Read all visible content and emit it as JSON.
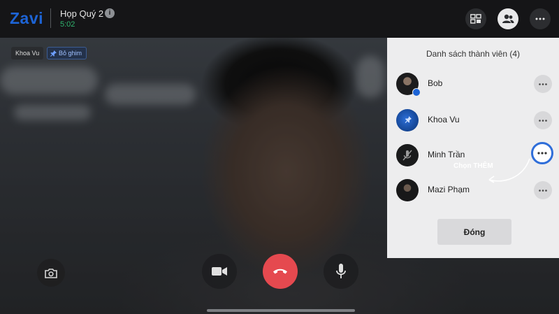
{
  "header": {
    "logo": "Zavi",
    "meeting_title": "Họp Quý 2",
    "info_glyph": "i",
    "timer": "5:02",
    "icons": [
      "layout-icon",
      "members-icon",
      "more-icon"
    ]
  },
  "video": {
    "name_tag": "Khoa Vu",
    "pin_tag": "Bỏ ghim"
  },
  "members_panel": {
    "title": "Danh sách thành viên (4)",
    "members": [
      {
        "name": "Bob"
      },
      {
        "name": "Khoa Vu"
      },
      {
        "name": "Minh Trần"
      },
      {
        "name": "Mazi Phạm"
      }
    ],
    "close_label": "Đóng"
  },
  "annotation": {
    "text": "Chọn THÊM"
  },
  "colors": {
    "brand": "#1d64d6",
    "timer": "#2fb36d",
    "end_call": "#e5494f",
    "highlight": "#2f6ed9"
  }
}
